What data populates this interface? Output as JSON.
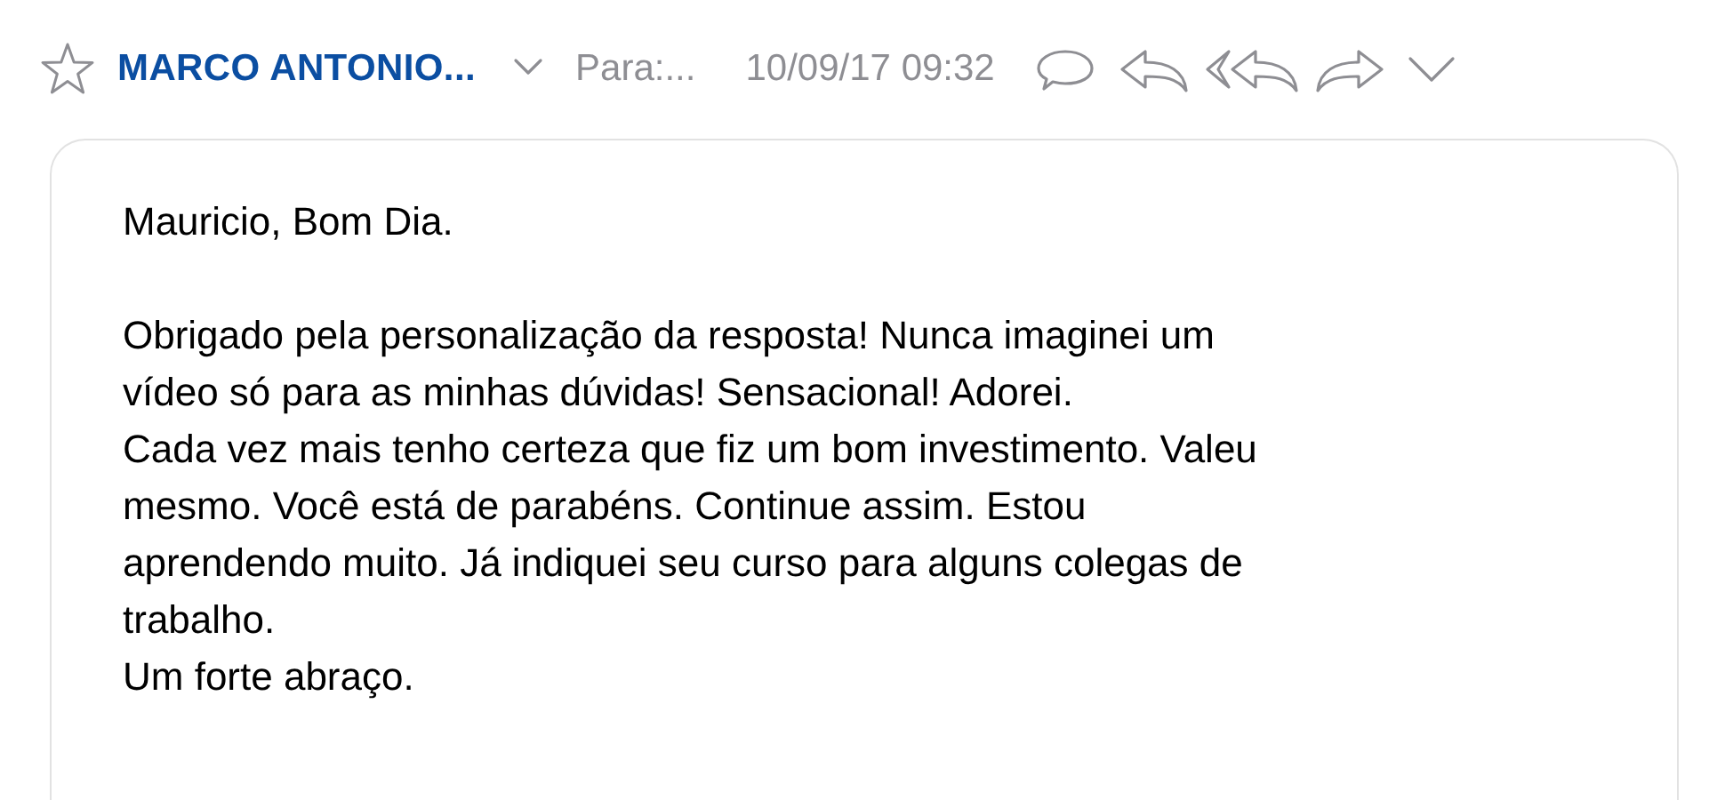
{
  "header": {
    "sender": "MARCO ANTONIO...",
    "recipient": "Para:...",
    "date": "10/09/17 09:32"
  },
  "message": {
    "paragraphs": [
      [
        "Mauricio, Bom Dia."
      ],
      [
        "Obrigado pela personalização da resposta! Nunca imaginei um",
        "vídeo só para as minhas dúvidas! Sensacional! Adorei.",
        "Cada vez mais tenho certeza que fiz um bom investimento. Valeu",
        "mesmo. Você está de parabéns. Continue assim. Estou",
        "aprendendo muito. Já indiquei seu curso para alguns colegas de",
        "trabalho.",
        "Um forte abraço."
      ]
    ]
  }
}
